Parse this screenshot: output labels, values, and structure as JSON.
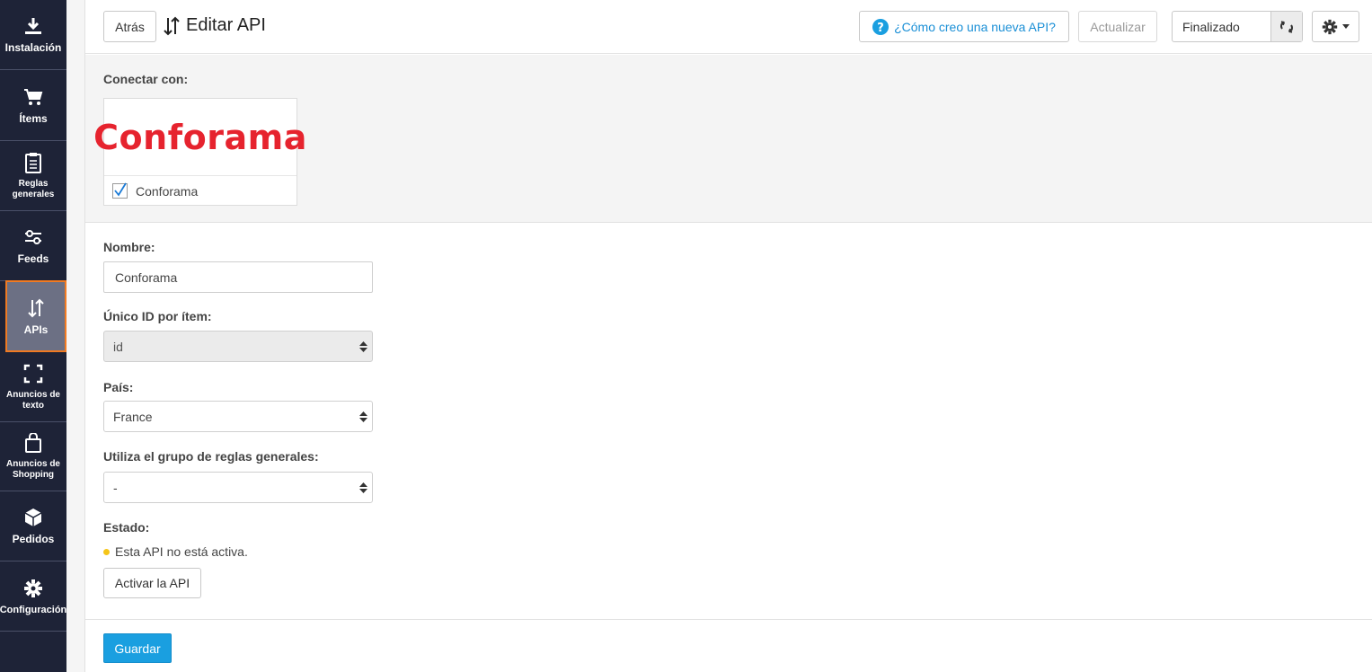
{
  "sidebar": {
    "items": [
      {
        "label": "Instalación",
        "icon": "download-icon"
      },
      {
        "label": "Ítems",
        "icon": "cart-icon"
      },
      {
        "label": "Reglas generales",
        "icon": "clipboard-icon"
      },
      {
        "label": "Feeds",
        "icon": "sliders-icon"
      },
      {
        "label": "APIs",
        "icon": "swap-vertical-icon"
      },
      {
        "label": "Anuncios de texto",
        "icon": "frame-icon"
      },
      {
        "label": "Anuncios de Shopping",
        "icon": "shopping-bag-icon"
      },
      {
        "label": "Pedidos",
        "icon": "box-icon"
      },
      {
        "label": "Configuración",
        "icon": "gear-icon"
      }
    ],
    "active": "APIs"
  },
  "header": {
    "back_label": "Atrás",
    "title": "Editar API",
    "help_label": "¿Cómo creo una nueva API?",
    "update_label": "Actualizar",
    "status_label": "Finalizado"
  },
  "connect": {
    "label": "Conectar con:",
    "card": {
      "logo_text": "Conforama",
      "name": "Conforama",
      "checked": true
    }
  },
  "form": {
    "name_label": "Nombre:",
    "name_value": "Conforama",
    "unique_id_label": "Único ID por ítem:",
    "unique_id_value": "id",
    "country_label": "País:",
    "country_value": "France",
    "rules_label": "Utiliza el grupo de reglas generales:",
    "rules_value": "-",
    "state_label": "Estado:",
    "state_text": "Esta API no está activa.",
    "activate_label": "Activar la API"
  },
  "footer": {
    "save_label": "Guardar"
  },
  "colors": {
    "sidebar": "#1e2337",
    "accent": "#1a9fe0",
    "active_border": "#f07a22",
    "brand": "#e6232e",
    "status_dot": "#f5c518"
  }
}
